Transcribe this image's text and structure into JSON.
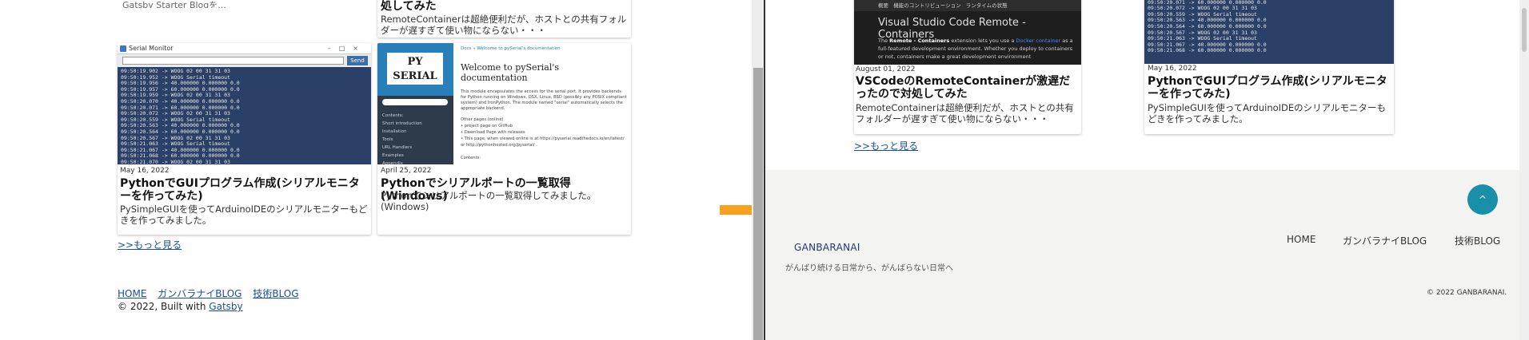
{
  "left": {
    "card_top_left_desc": "Gatsby Starter Blogを...",
    "card_top_right": {
      "title_tail": "処してみた",
      "desc": "RemoteContainerは超絶便利だが、ホストとの共有フォルダーが遅すぎて使い物にならない・・・"
    },
    "card_serial": {
      "window_title": "Serial Monitor",
      "send_label": "Send",
      "log": "09:50:19.902 -> WOOG 02 00 31 31 03\n09:50:19.952 -> WOOG Serial timeout\n09:50:19.956 -> 40.000000 0.000000 0.0\n09:50:19.957 -> 60.000000 0.000000 0.0\n09:50:19.959 -> WOOG 02 00 31 31 03\n09:50:20.070 -> 40.000000 0.000000 0.0\n09:50:20.071 -> 60.000000 0.000000 0.0\n09:50:20.072 -> WOOG 02 00 31 31 03\n09:50:20.559 -> WOOG Serial timeout\n09:50:20.563 -> 40.000000 0.000000 0.0\n09:50:20.564 -> 60.000000 0.000000 0.0\n09:50:20.567 -> WOOG 02 00 31 31 03\n09:50:21.063 -> WOOG Serial timeout\n09:50:21.067 -> 40.000000 0.000000 0.0\n09:50:21.068 -> 60.000000 0.000000 0.0\n09:50:21.070 -> WOOG 02 00 31 31 03",
      "date": "May 16, 2022",
      "title": "PythonでGUIプログラム作成(シリアルモニターを作ってみた)",
      "desc": "PySimpleGUIを使ってArduinoIDEのシリアルモニターもどきを作ってみました。"
    },
    "card_pyserial": {
      "logo_text": "PY SERIAL",
      "crumb": "Docs » Welcome to pySerial's documentation",
      "heading": "Welcome to pySerial's documentation",
      "para": "This module encapsulates the access for the serial port. It provides backends for Python running on Windows, OSX, Linux, BSD (possibly any POSIX compliant system) and IronPython. The module named \"serial\" automatically selects the appropriate backend.",
      "links": "Other pages (online)\n• project page on GitHub\n• Download Page with releases\n• This page, when viewed online is at https://pyserial.readthedocs.io/en/latest/ or http://pythonhosted.org/pyserial/ .\n\nContents:",
      "sidebar_items": "Contents:\nShort introduction\nInstallation\nTools\nURL Handlers\nExamples\nAppendix",
      "date": "April 25, 2022",
      "title": "Pythonでシリアルポートの一覧取得(Windows)",
      "desc": "Pythonでシリアルポートの一覧取得してみました。(Windows)"
    },
    "more_link": ">>もっと見る",
    "footer_links": [
      "HOME",
      "ガンバラナイBLOG",
      "技術BLOG"
    ],
    "footer_copy_prefix": "© 2022, Built with",
    "footer_copy_link": "Gatsby"
  },
  "right": {
    "card_vscode": {
      "tabs": "概要   機能のコントリビューション   ランタイムの状態",
      "slide_title": "Visual Studio Code Remote - Containers",
      "slide_text_a": "The",
      "slide_text_b": "Remote - Containers",
      "slide_text_c": "extension lets you use a",
      "slide_text_d": "Docker container",
      "slide_text_e": "as a full-featured development environment. Whether you deploy to containers or not, containers make a great development environment",
      "date": "August 01, 2022",
      "title": "VSCodeのRemoteContainerが激遅だったので対処してみた",
      "desc": "RemoteContainerは超絶便利だが、ホストとの共有フォルダーが遅すぎて使い物にならない・・・"
    },
    "card_serial": {
      "log": "09:50:20.070 -> 40.000000 0.000000 0.0\n09:50:20.071 -> 60.000000 0.000000 0.0\n09:50:20.072 -> WOOG 02 00 31 31 03\n09:50:20.559 -> WOOG Serial timeout\n09:50:20.563 -> 40.000000 0.000000 0.0\n09:50:20.564 -> 60.000000 0.000000 0.0\n09:50:20.567 -> WOOG 02 00 31 31 03\n09:50:21.063 -> WOOG Serial timeout\n09:50:21.067 -> 40.000000 0.000000 0.0\n09:50:21.068 -> 60.000000 0.000000 0.0",
      "date": "May 16, 2022",
      "title": "PythonでGUIプログラム作成(シリアルモニターを作ってみた)",
      "desc": "PySimpleGUIを使ってArduinoIDEのシリアルモニターもどきを作ってみました。"
    },
    "more_link": ">>もっと見る",
    "back_to_top_icon": "^",
    "brand": "GANBARANAI",
    "tagline": "がんばり続ける日常から、がんばらない日常へ",
    "nav": [
      "HOME",
      "ガンバラナイBLOG",
      "技術BLOG"
    ],
    "copyright": "© 2022 GANBARANAI."
  },
  "colors": {
    "arrow": "#f7a11c",
    "accent_button": "#1a90a8",
    "link": "#1a4fa0"
  }
}
